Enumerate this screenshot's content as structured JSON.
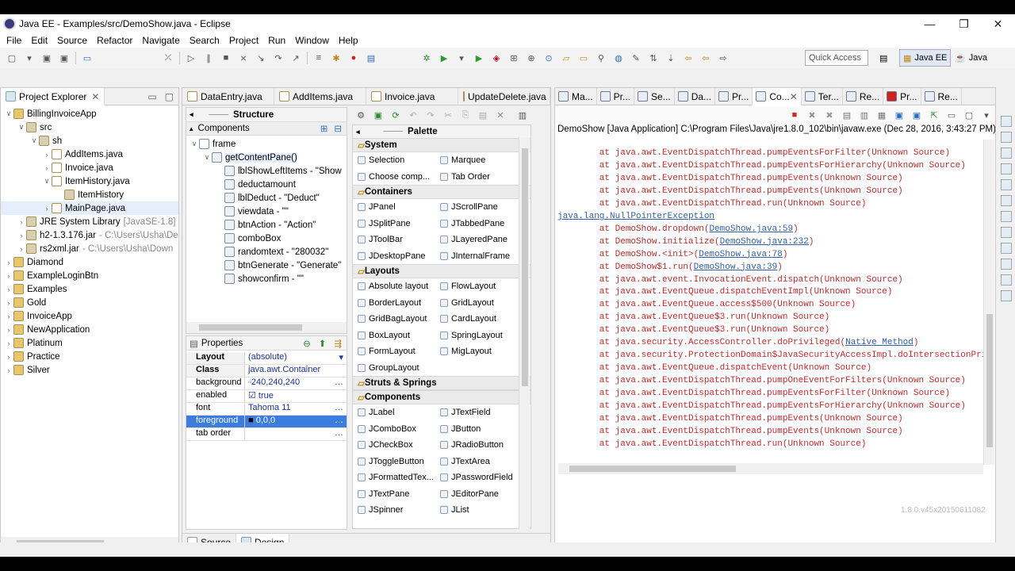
{
  "window": {
    "title": "Java EE - Examples/src/DemoShow.java - Eclipse",
    "controls": [
      "—",
      "❐",
      "✕"
    ]
  },
  "menu": [
    "File",
    "Edit",
    "Source",
    "Refactor",
    "Navigate",
    "Search",
    "Project",
    "Run",
    "Window",
    "Help"
  ],
  "quick_access": "Quick Access",
  "perspectives": {
    "java_ee": "Java EE",
    "java": "Java"
  },
  "project_explorer": {
    "title": "Project Explorer",
    "items": [
      {
        "label": "BillingInvoiceApp",
        "indent": 0,
        "tw": "∨"
      },
      {
        "label": "src",
        "indent": 1,
        "tw": "∨"
      },
      {
        "label": "sh",
        "indent": 2,
        "tw": "∨"
      },
      {
        "label": "AddItems.java",
        "indent": 3,
        "tw": "›"
      },
      {
        "label": "Invoice.java",
        "indent": 3,
        "tw": "›"
      },
      {
        "label": "ItemHistory.java",
        "indent": 3,
        "tw": "∨"
      },
      {
        "label": "ItemHistory",
        "indent": 4,
        "tw": ""
      },
      {
        "label": "MainPage.java",
        "indent": 3,
        "tw": "›",
        "selected": true
      },
      {
        "label": "JRE System Library",
        "suffix": "[JavaSE-1.8]",
        "indent": 1,
        "tw": "›"
      },
      {
        "label": "h2-1.3.176.jar",
        "suffix": "- C:\\Users\\Usha\\De",
        "indent": 1,
        "tw": "›"
      },
      {
        "label": "rs2xml.jar",
        "suffix": "- C:\\Users\\Usha\\Down",
        "indent": 1,
        "tw": "›"
      },
      {
        "label": "Diamond",
        "indent": 0,
        "tw": "›"
      },
      {
        "label": "ExampleLoginBtn",
        "indent": 0,
        "tw": "›"
      },
      {
        "label": "Examples",
        "indent": 0,
        "tw": "›"
      },
      {
        "label": "Gold",
        "indent": 0,
        "tw": "›"
      },
      {
        "label": "InvoiceApp",
        "indent": 0,
        "tw": "›"
      },
      {
        "label": "NewApplication",
        "indent": 0,
        "tw": "›"
      },
      {
        "label": "Platinum",
        "indent": 0,
        "tw": "›"
      },
      {
        "label": "Practice",
        "indent": 0,
        "tw": "›"
      },
      {
        "label": "Silver",
        "indent": 0,
        "tw": "›"
      }
    ]
  },
  "editor_tabs": [
    "DataEntry.java",
    "AddItems.java",
    "Invoice.java",
    "UpdateDelete.java"
  ],
  "structure": {
    "title": "Structure",
    "components_label": "Components",
    "items": [
      {
        "label": "frame",
        "indent": 0
      },
      {
        "label": "getContentPane()",
        "indent": 1,
        "selected": true
      },
      {
        "label": "lblShowLeftItems - \"Show",
        "indent": 2
      },
      {
        "label": "deductamount",
        "indent": 2
      },
      {
        "label": "lblDeduct - \"Deduct\"",
        "indent": 2
      },
      {
        "label": "viewdata - \"\"",
        "indent": 2
      },
      {
        "label": "btnAction - \"Action\"",
        "indent": 2
      },
      {
        "label": "comboBox",
        "indent": 2
      },
      {
        "label": "randomtext - \"280032\"",
        "indent": 2
      },
      {
        "label": "btnGenerate - \"Generate\"",
        "indent": 2
      },
      {
        "label": "showconfirm - \"\"",
        "indent": 2
      }
    ]
  },
  "properties": {
    "title": "Properties",
    "rows": [
      {
        "k": "Layout",
        "v": "(absolute)",
        "bold": true
      },
      {
        "k": "Class",
        "v": "java.awt.Container",
        "bold": true
      },
      {
        "k": "background",
        "v": "240,240,240"
      },
      {
        "k": "enabled",
        "v": "true"
      },
      {
        "k": "font",
        "v": "Tahoma 11"
      },
      {
        "k": "foreground",
        "v": "0,0,0",
        "hl": true
      },
      {
        "k": "tab order",
        "v": ""
      }
    ]
  },
  "palette": {
    "title": "Palette",
    "sections": [
      {
        "name": "System",
        "rows": [
          [
            "Selection",
            "Marquee"
          ],
          [
            "Choose comp...",
            "Tab Order"
          ]
        ]
      },
      {
        "name": "Containers",
        "rows": [
          [
            "JPanel",
            "JScrollPane"
          ],
          [
            "JSplitPane",
            "JTabbedPane"
          ],
          [
            "JToolBar",
            "JLayeredPane"
          ],
          [
            "JDesktopPane",
            "JInternalFrame"
          ]
        ]
      },
      {
        "name": "Layouts",
        "rows": [
          [
            "Absolute layout",
            "FlowLayout"
          ],
          [
            "BorderLayout",
            "GridLayout"
          ],
          [
            "GridBagLayout",
            "CardLayout"
          ],
          [
            "BoxLayout",
            "SpringLayout"
          ],
          [
            "FormLayout",
            "MigLayout"
          ],
          [
            "GroupLayout",
            ""
          ]
        ]
      },
      {
        "name": "Struts & Springs",
        "rows": []
      },
      {
        "name": "Components",
        "rows": [
          [
            "JLabel",
            "JTextField"
          ],
          [
            "JComboBox",
            "JButton"
          ],
          [
            "JCheckBox",
            "JRadioButton"
          ],
          [
            "JToggleButton",
            "JTextArea"
          ],
          [
            "JFormattedTex...",
            "JPasswordField"
          ],
          [
            "JTextPane",
            "JEditorPane"
          ],
          [
            "JSpinner",
            "JList"
          ]
        ]
      }
    ]
  },
  "bottom_tabs": [
    "Source",
    "Design"
  ],
  "console_tabs": [
    "Ma...",
    "Pr...",
    "Se...",
    "Da...",
    "Pr...",
    "Co...",
    "Ter...",
    "Re...",
    "Pr...",
    "Re..."
  ],
  "console": {
    "header": "DemoShow [Java Application] C:\\Program Files\\Java\\jre1.8.0_102\\bin\\javaw.exe (Dec 28, 2016, 3:43:27 PM)",
    "lines": [
      {
        "t": "        at java.awt.EventDispatchThread.pumpEventsForFilter(Unknown Source)"
      },
      {
        "t": "        at java.awt.EventDispatchThread.pumpEventsForHierarchy(Unknown Source)"
      },
      {
        "t": "        at java.awt.EventDispatchThread.pumpEvents(Unknown Source)"
      },
      {
        "t": "        at java.awt.EventDispatchThread.pumpEvents(Unknown Source)"
      },
      {
        "t": "        at java.awt.EventDispatchThread.run(Unknown Source)"
      },
      {
        "exc": "java.lang.NullPointerException"
      },
      {
        "t": "        at DemoShow.dropdown(",
        "link": "DemoShow.java:59",
        "end": ")"
      },
      {
        "t": "        at DemoShow.initialize(",
        "link": "DemoShow.java:232",
        "end": ")"
      },
      {
        "t": "        at DemoShow.<init>(",
        "link": "DemoShow.java:78",
        "end": ")"
      },
      {
        "t": "        at DemoShow$1.run(",
        "link": "DemoShow.java:39",
        "end": ")"
      },
      {
        "t": "        at java.awt.event.InvocationEvent.dispatch(Unknown Source)"
      },
      {
        "t": "        at java.awt.EventQueue.dispatchEventImpl(Unknown Source)"
      },
      {
        "t": "        at java.awt.EventQueue.access$500(Unknown Source)"
      },
      {
        "t": "        at java.awt.EventQueue$3.run(Unknown Source)"
      },
      {
        "t": "        at java.awt.EventQueue$3.run(Unknown Source)"
      },
      {
        "t": "        at java.security.AccessController.doPrivileged(",
        "link": "Native Method",
        "end": ")"
      },
      {
        "t": "        at java.security.ProtectionDomain$JavaSecurityAccessImpl.doIntersectionPrivilege(Unknown Source)"
      },
      {
        "t": "        at java.awt.EventQueue.dispatchEvent(Unknown Source)"
      },
      {
        "t": "        at java.awt.EventDispatchThread.pumpOneEventForFilters(Unknown Source)"
      },
      {
        "t": "        at java.awt.EventDispatchThread.pumpEventsForFilter(Unknown Source)"
      },
      {
        "t": "        at java.awt.EventDispatchThread.pumpEventsForHierarchy(Unknown Source)"
      },
      {
        "t": "        at java.awt.EventDispatchThread.pumpEvents(Unknown Source)"
      },
      {
        "t": "        at java.awt.EventDispatchThread.pumpEvents(Unknown Source)"
      },
      {
        "t": "        at java.awt.EventDispatchThread.run(Unknown Source)"
      }
    ]
  },
  "version": "1.8.0.v45x20150611082"
}
